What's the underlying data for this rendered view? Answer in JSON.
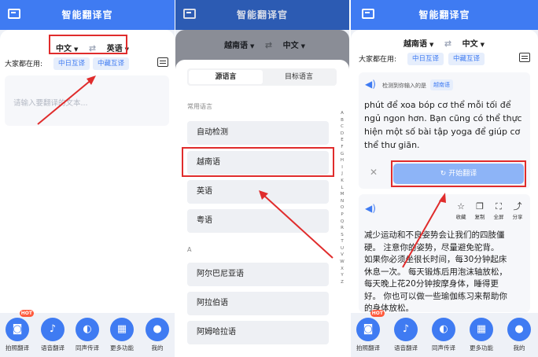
{
  "app": {
    "title": "智能翻译官"
  },
  "panel1": {
    "source_lang": "中文",
    "target_lang": "英语",
    "common_label": "大家都在用:",
    "chips": [
      "中日互译",
      "中藏互译"
    ],
    "input_placeholder": "请输入要翻译的文本..."
  },
  "panel2": {
    "source_lang": "越南语",
    "target_lang": "中文",
    "tabs": [
      "源语言",
      "目标语言"
    ],
    "section_common": "常用语言",
    "section_a": "A",
    "common_langs": [
      "自动检测",
      "越南语",
      "英语",
      "粤语"
    ],
    "a_langs": [
      "阿尔巴尼亚语",
      "阿拉伯语",
      "阿姆哈拉语"
    ],
    "alphabet": [
      "A",
      "B",
      "C",
      "D",
      "E",
      "F",
      "G",
      "H",
      "I",
      "J",
      "K",
      "L",
      "M",
      "N",
      "O",
      "P",
      "Q",
      "R",
      "S",
      "T",
      "U",
      "V",
      "W",
      "X",
      "Y",
      "Z"
    ]
  },
  "panel3": {
    "source_lang": "越南语",
    "target_lang": "中文",
    "common_label": "大家都在用:",
    "chips": [
      "中日互译",
      "中藏互译"
    ],
    "detect_text": "检测到你输入的是",
    "detect_badge": "越南语",
    "source_lines": [
      "phút để xoa bóp cơ thể mỗi tối để",
      "ngủ ngon hơn. Bạn cũng có thể thực",
      "hiện một số bài tập yoga để giúp cơ",
      "thể thư giãn."
    ],
    "start_label": "开始翻译",
    "actions": [
      "收藏",
      "复制",
      "全屏",
      "分享"
    ],
    "result_lines": [
      "减少运动和不良姿势会让我们的四肢僵",
      "硬。 注意你的姿势，尽量避免驼背。",
      "如果你必须坐很长时间，每30分钟起床",
      "休息一次。 每天锻炼后用泡沫轴放松，",
      "每天晚上花20分钟按摩身体，睡得更",
      "好。 你也可以做一些瑜伽练习来帮助你",
      "的身体放松。"
    ]
  },
  "nav": {
    "items": [
      "拍照翻译",
      "语音翻译",
      "同声传译",
      "更多功能",
      "我的"
    ],
    "hot_badge": "HOT"
  },
  "colors": {
    "brand": "#3f7bf2",
    "annotation": "#e02c2c"
  }
}
